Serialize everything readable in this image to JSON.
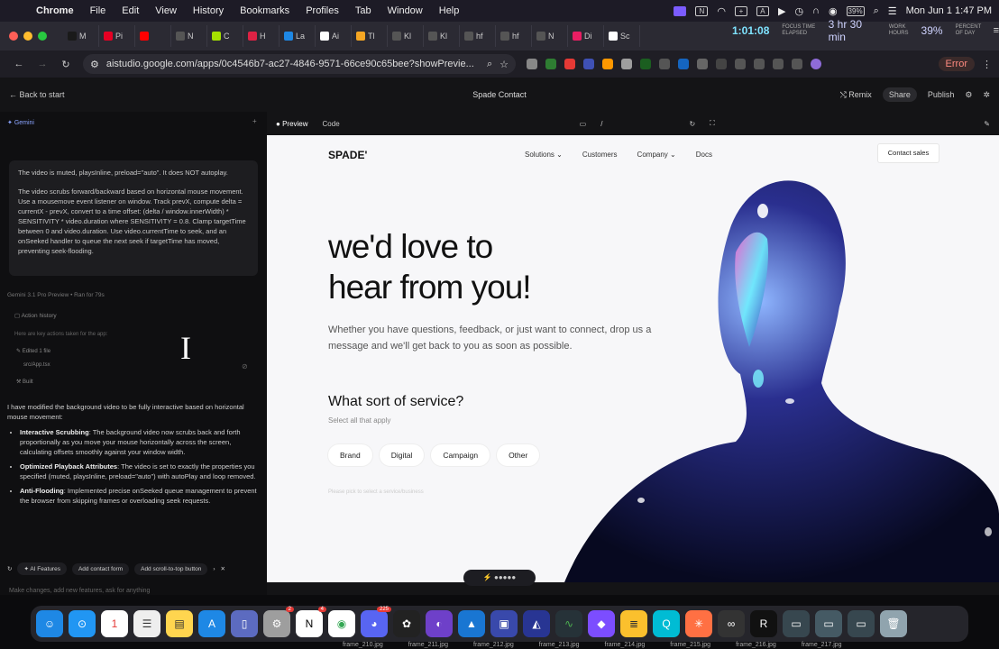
{
  "menubar": {
    "app": "Chrome",
    "items": [
      "File",
      "Edit",
      "View",
      "History",
      "Bookmarks",
      "Profiles",
      "Tab",
      "Window",
      "Help"
    ],
    "battery": "39%",
    "datetime": "Mon Jun 1  1:47 PM"
  },
  "tabs": [
    {
      "label": "M",
      "color": "#1a1a1a"
    },
    {
      "label": "Pi",
      "color": "#e60023"
    },
    {
      "label": "",
      "color": "#ff0000"
    },
    {
      "label": "N",
      "color": "#555"
    },
    {
      "label": "C",
      "color": "#a4e000"
    },
    {
      "label": "H",
      "color": "#d24"
    },
    {
      "label": "La",
      "color": "#1e88e5"
    },
    {
      "label": "Ai",
      "color": "#fff"
    },
    {
      "label": "Tl",
      "color": "#f5a623"
    },
    {
      "label": "Kl",
      "color": "#555"
    },
    {
      "label": "Kl",
      "color": "#555"
    },
    {
      "label": "hf",
      "color": "#555"
    },
    {
      "label": "hf",
      "color": "#555"
    },
    {
      "label": "N",
      "color": "#555"
    },
    {
      "label": "Di",
      "color": "#e91e63"
    },
    {
      "label": "Sc",
      "color": "#fff"
    }
  ],
  "timer": {
    "elapsed": "1:01:08",
    "elapsed_label": "FOCUS TIME ELAPSED",
    "work": "3 hr 30 min",
    "work_label": "WORK HOURS",
    "pct": "39%",
    "pct_label": "PERCENT OF DAY"
  },
  "browser": {
    "url": "aistudio.google.com/apps/0c4546b7-ac27-4846-9571-66ce90c65bee?showPrevie...",
    "error_label": "Error"
  },
  "app": {
    "back": "Back to start",
    "title": "Spade Contact",
    "remix": "Remix",
    "share": "Share",
    "publish": "Publish",
    "tab_preview": "Preview",
    "tab_code": "Code",
    "path": "/"
  },
  "chat": {
    "header": "Gemini",
    "msg1": "The video is muted, playsInline, preload=\"auto\". It does NOT autoplay.",
    "msg2": "The video scrubs forward/backward based on horizontal mouse movement. Use a mousemove event listener on window. Track prevX, compute delta = currentX - prevX, convert to a time offset: (delta / window.innerWidth) * SENSITIVITY * video.duration where SENSITIVITY = 0.8. Clamp targetTime between 0 and video.duration. Use video.currentTime to seek, and an onSeeked handler to queue the next seek if targetTime has moved, preventing seek-flooding.",
    "model": "Gemini 3.1 Pro Preview  •  Ran for 79s",
    "action_history": "Action history",
    "action_desc": "Here are key actions taken for the app:",
    "edited": "Edited 1 file",
    "file": "src/App.tsx",
    "built": "Built",
    "reply_intro": "I have modified the background video to be fully interactive based on horizontal mouse movement:",
    "bullets": [
      {
        "title": "Interactive Scrubbing",
        "text": ": The background video now scrubs back and forth proportionally as you move your mouse horizontally across the screen, calculating offsets smoothly against your window width."
      },
      {
        "title": "Optimized Playback Attributes",
        "text": ": The video is set to exactly the properties you specified (muted, playsInline, preload=\"auto\") with autoPlay and loop removed."
      },
      {
        "title": "Anti-Flooding",
        "text": ": Implemented precise onSeeked queue management to prevent the browser from skipping frames or overloading seek requests."
      }
    ],
    "chips": [
      "AI Features",
      "Add contact form",
      "Add scroll-to-top button"
    ],
    "placeholder": "Make changes, add new features, ask for anything"
  },
  "site": {
    "logo": "SPADE'",
    "nav": [
      "Solutions",
      "Customers",
      "Company",
      "Docs"
    ],
    "contact": "Contact sales",
    "hero_line1": "we'd love to",
    "hero_line2": "hear from you!",
    "sub": "Whether you have questions, feedback, or just want to connect, drop us a message and we'll get back to you as soon as possible.",
    "question": "What sort of service?",
    "question_sub": "Select all that apply",
    "options": [
      "Brand",
      "Digital",
      "Campaign",
      "Other"
    ],
    "faint": "Please pick to select a service/business"
  },
  "dock": {
    "notion_badge": "4",
    "discord_badge": "225",
    "settings_badge": "2"
  },
  "frames": [
    "frame_210.jpg",
    "frame_211.jpg",
    "frame_212.jpg",
    "frame_213.jpg",
    "frame_214.jpg",
    "frame_215.jpg",
    "frame_216.jpg",
    "frame_217.jpg"
  ]
}
